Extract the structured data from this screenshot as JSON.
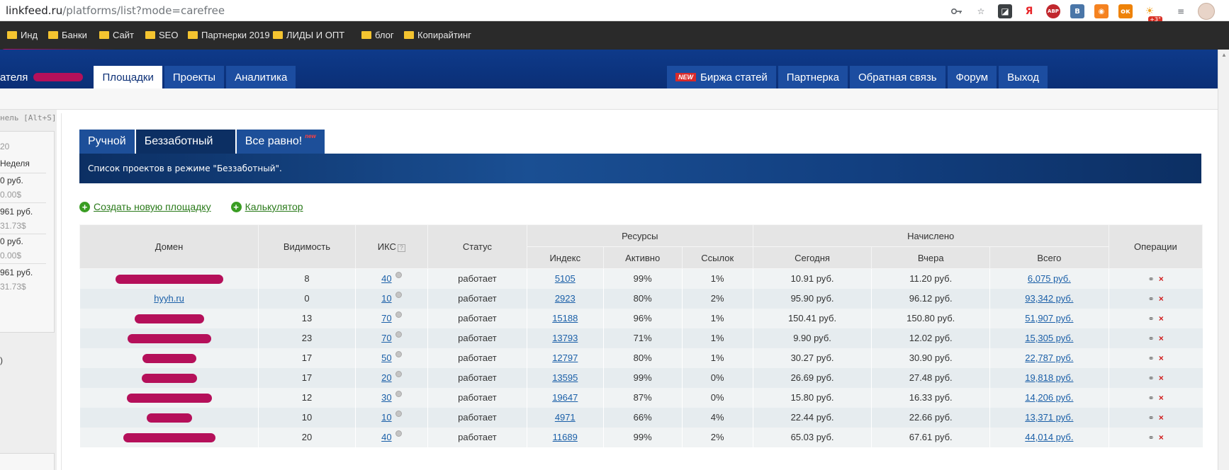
{
  "browser": {
    "url_host": "linkfeed.ru",
    "url_path": "/platforms/list?mode=carefree",
    "icons": [
      "key-icon",
      "star-icon",
      "extension-icon",
      "yandex-icon",
      "adblock-icon",
      "vk-icon",
      "rss-icon",
      "odnoklassniki-icon",
      "weather-icon",
      "queue-icon",
      "avatar"
    ],
    "ext_labels": {
      "adblock": "ABP",
      "vk": "B",
      "weather_badge": "+3°"
    }
  },
  "bookmarks": [
    {
      "label": "Инд"
    },
    {
      "label": "Банки"
    },
    {
      "label": "Сайт"
    },
    {
      "label": "SEO"
    },
    {
      "label": "Партнерки 2019"
    },
    {
      "label": "ЛИДЫ И ОПТ"
    },
    {
      "label": "блог"
    },
    {
      "label": "Копирайтинг"
    }
  ],
  "nav": {
    "user_stub": "ателя",
    "left": [
      {
        "label": "Площадки",
        "active": true
      },
      {
        "label": "Проекты",
        "active": false
      },
      {
        "label": "Аналитика",
        "active": false
      }
    ],
    "new_badge": "NEW",
    "right": [
      "Биржа статей",
      "Партнерка",
      "Обратная связь",
      "Форум",
      "Выход"
    ]
  },
  "side": {
    "hint": "нель [Alt+S]",
    "lines": [
      "20",
      "Неделя",
      "0 руб.",
      "0.00$",
      "961 руб.",
      "31.73$",
      "0 руб.",
      "0.00$",
      "961 руб.",
      "31.73$"
    ],
    "paren": ")"
  },
  "mode_tabs": [
    {
      "label": "Ручной",
      "active": false
    },
    {
      "label": "Беззаботный",
      "active": true
    },
    {
      "label": "Все равно!",
      "active": false,
      "sup": "new"
    }
  ],
  "mode_description": "Список проектов в режиме \"Беззаботный\".",
  "actions": {
    "create": "Создать новую площадку",
    "calculator": "Калькулятор"
  },
  "table": {
    "headers": {
      "domain": "Домен",
      "visibility": "Видимость",
      "iks": "ИКС",
      "iks_help": "?",
      "status": "Статус",
      "resources": "Ресурсы",
      "index": "Индекс",
      "active": "Активно",
      "links": "Ссылок",
      "accrued": "Начислено",
      "today": "Сегодня",
      "yesterday": "Вчера",
      "total": "Всего",
      "operations": "Операции"
    },
    "op_delete": "×",
    "op_edit": "⚭",
    "rows": [
      {
        "domain": "",
        "visibility": "8",
        "iks": "40",
        "status": "работает",
        "index": "5105",
        "active": "99%",
        "links": "1%",
        "today": "10.91 руб.",
        "yesterday": "11.20 руб.",
        "total": "6,075 руб."
      },
      {
        "domain": "hyyh.ru",
        "visibility": "0",
        "iks": "10",
        "status": "работает",
        "index": "2923",
        "active": "80%",
        "links": "2%",
        "today": "95.90 руб.",
        "yesterday": "96.12 руб.",
        "total": "93,342 руб."
      },
      {
        "domain": "",
        "visibility": "13",
        "iks": "70",
        "status": "работает",
        "index": "15188",
        "active": "96%",
        "links": "1%",
        "today": "150.41 руб.",
        "yesterday": "150.80 руб.",
        "total": "51,907 руб."
      },
      {
        "domain": "",
        "visibility": "23",
        "iks": "70",
        "status": "работает",
        "index": "13793",
        "active": "71%",
        "links": "1%",
        "today": "9.90 руб.",
        "yesterday": "12.02 руб.",
        "total": "15,305 руб."
      },
      {
        "domain": "",
        "visibility": "17",
        "iks": "50",
        "status": "работает",
        "index": "12797",
        "active": "80%",
        "links": "1%",
        "today": "30.27 руб.",
        "yesterday": "30.90 руб.",
        "total": "22,787 руб."
      },
      {
        "domain": "",
        "visibility": "17",
        "iks": "20",
        "status": "работает",
        "index": "13595",
        "active": "99%",
        "links": "0%",
        "today": "26.69 руб.",
        "yesterday": "27.48 руб.",
        "total": "19,818 руб."
      },
      {
        "domain": "",
        "visibility": "12",
        "iks": "30",
        "status": "работает",
        "index": "19647",
        "active": "87%",
        "links": "0%",
        "today": "15.80 руб.",
        "yesterday": "16.33 руб.",
        "total": "14,206 руб."
      },
      {
        "domain": "",
        "visibility": "10",
        "iks": "10",
        "status": "работает",
        "index": "4971",
        "active": "66%",
        "links": "4%",
        "today": "22.44 руб.",
        "yesterday": "22.66 руб.",
        "total": "13,371 руб."
      },
      {
        "domain": "",
        "visibility": "20",
        "iks": "40",
        "status": "работает",
        "index": "11689",
        "active": "99%",
        "links": "2%",
        "today": "65.03 руб.",
        "yesterday": "67.61 руб.",
        "total": "44,014 руб."
      }
    ]
  },
  "colors": {
    "header_blue": "#0b2f76",
    "accent_red": "#b5105a",
    "link_green": "#2a7a1a",
    "link_blue": "#1a5fa8",
    "delete_red": "#d01c1c"
  }
}
